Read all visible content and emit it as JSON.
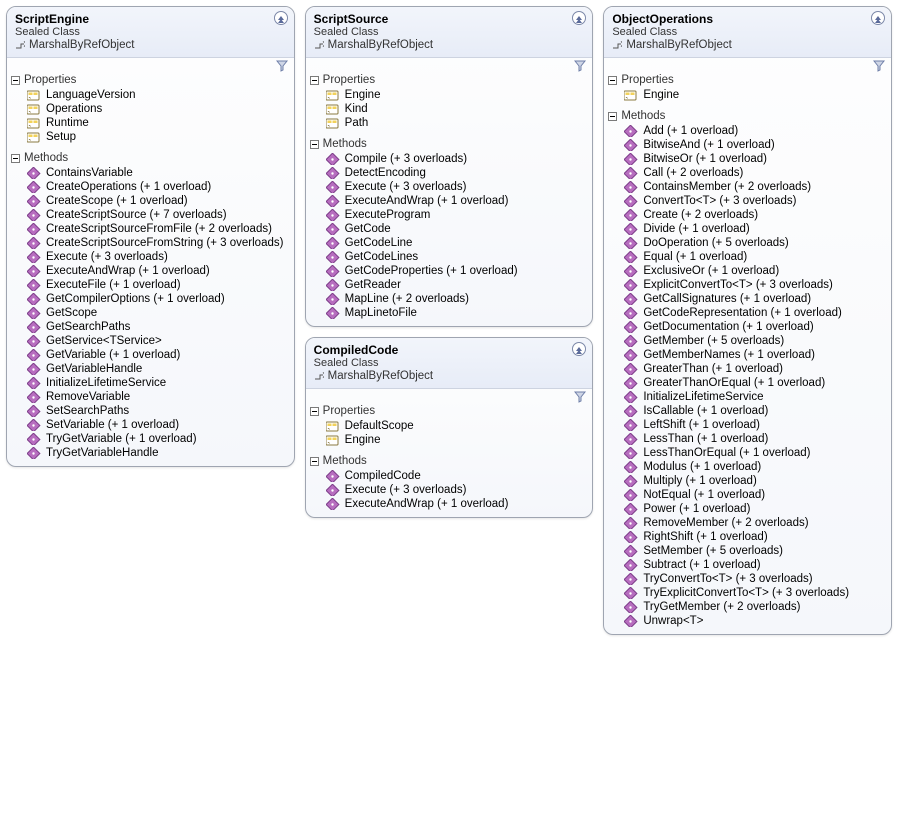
{
  "common": {
    "stereotype": "Sealed Class",
    "base": "MarshalByRefObject",
    "section_properties": "Properties",
    "section_methods": "Methods"
  },
  "classes": [
    {
      "id": "script-engine",
      "name": "ScriptEngine",
      "properties": [
        "LanguageVersion",
        "Operations",
        "Runtime",
        "Setup"
      ],
      "methods": [
        "ContainsVariable",
        "CreateOperations (+ 1 overload)",
        "CreateScope (+ 1 overload)",
        "CreateScriptSource (+ 7 overloads)",
        "CreateScriptSourceFromFile (+ 2 overloads)",
        "CreateScriptSourceFromString (+ 3 overloads)",
        "Execute (+ 3 overloads)",
        "ExecuteAndWrap (+ 1 overload)",
        "ExecuteFile (+ 1 overload)",
        "GetCompilerOptions (+ 1 overload)",
        "GetScope",
        "GetSearchPaths",
        "GetService<TService>",
        "GetVariable (+ 1 overload)",
        "GetVariableHandle",
        "InitializeLifetimeService",
        "RemoveVariable",
        "SetSearchPaths",
        "SetVariable (+ 1 overload)",
        "TryGetVariable (+ 1 overload)",
        "TryGetVariableHandle"
      ]
    },
    {
      "id": "script-source",
      "name": "ScriptSource",
      "properties": [
        "Engine",
        "Kind",
        "Path"
      ],
      "methods": [
        "Compile (+ 3 overloads)",
        "DetectEncoding",
        "Execute (+ 3 overloads)",
        "ExecuteAndWrap (+ 1 overload)",
        "ExecuteProgram",
        "GetCode",
        "GetCodeLine",
        "GetCodeLines",
        "GetCodeProperties (+ 1 overload)",
        "GetReader",
        "MapLine (+ 2 overloads)",
        "MapLinetoFile"
      ]
    },
    {
      "id": "compiled-code",
      "name": "CompiledCode",
      "properties": [
        "DefaultScope",
        "Engine"
      ],
      "methods": [
        "CompiledCode",
        "Execute (+ 3 overloads)",
        "ExecuteAndWrap (+ 1 overload)"
      ]
    },
    {
      "id": "object-operations",
      "name": "ObjectOperations",
      "properties": [
        "Engine"
      ],
      "methods": [
        "Add (+ 1 overload)",
        "BitwiseAnd (+ 1 overload)",
        "BitwiseOr (+ 1 overload)",
        "Call (+ 2 overloads)",
        "ContainsMember (+ 2 overloads)",
        "ConvertTo<T> (+ 3 overloads)",
        "Create (+ 2 overloads)",
        "Divide (+ 1 overload)",
        "DoOperation (+ 5 overloads)",
        "Equal (+ 1 overload)",
        "ExclusiveOr (+ 1 overload)",
        "ExplicitConvertTo<T> (+ 3 overloads)",
        "GetCallSignatures (+ 1 overload)",
        "GetCodeRepresentation (+ 1 overload)",
        "GetDocumentation (+ 1 overload)",
        "GetMember (+ 5 overloads)",
        "GetMemberNames (+ 1 overload)",
        "GreaterThan (+ 1 overload)",
        "GreaterThanOrEqual (+ 1 overload)",
        "InitializeLifetimeService",
        "IsCallable (+ 1 overload)",
        "LeftShift (+ 1 overload)",
        "LessThan (+ 1 overload)",
        "LessThanOrEqual (+ 1 overload)",
        "Modulus (+ 1 overload)",
        "Multiply (+ 1 overload)",
        "NotEqual (+ 1 overload)",
        "Power (+ 1 overload)",
        "RemoveMember (+ 2 overloads)",
        "RightShift (+ 1 overload)",
        "SetMember (+ 5 overloads)",
        "Subtract (+ 1 overload)",
        "TryConvertTo<T> (+ 3 overloads)",
        "TryExplicitConvertTo<T> (+ 3 overloads)",
        "TryGetMember (+ 2 overloads)",
        "Unwrap<T>"
      ]
    }
  ]
}
